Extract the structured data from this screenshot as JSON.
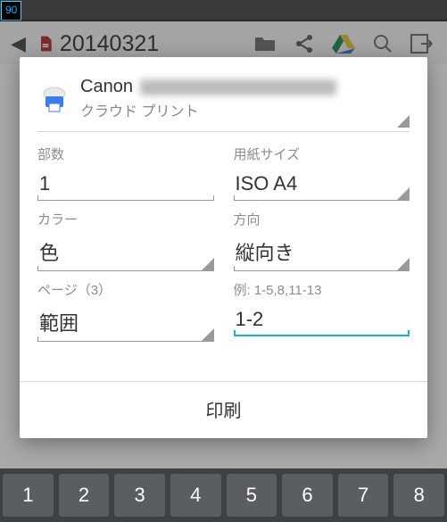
{
  "status": {
    "battery_text": "90"
  },
  "appbar": {
    "title": "20140321"
  },
  "dialog": {
    "printer": {
      "name_visible": "Canon",
      "subtitle": "クラウド プリント"
    },
    "fields": {
      "copies": {
        "label": "部数",
        "value": "1"
      },
      "paper": {
        "label": "用紙サイズ",
        "value": "ISO A4"
      },
      "color": {
        "label": "カラー",
        "value": "色"
      },
      "orient": {
        "label": "方向",
        "value": "縦向き"
      },
      "pages": {
        "label": "ページ（3）",
        "value": "範囲"
      },
      "range": {
        "label": "例: 1-5,8,11-13",
        "value": "1-2"
      }
    },
    "submit_label": "印刷"
  },
  "keyboard": {
    "keys": [
      "1",
      "2",
      "3",
      "4",
      "5",
      "6",
      "7",
      "8"
    ]
  }
}
